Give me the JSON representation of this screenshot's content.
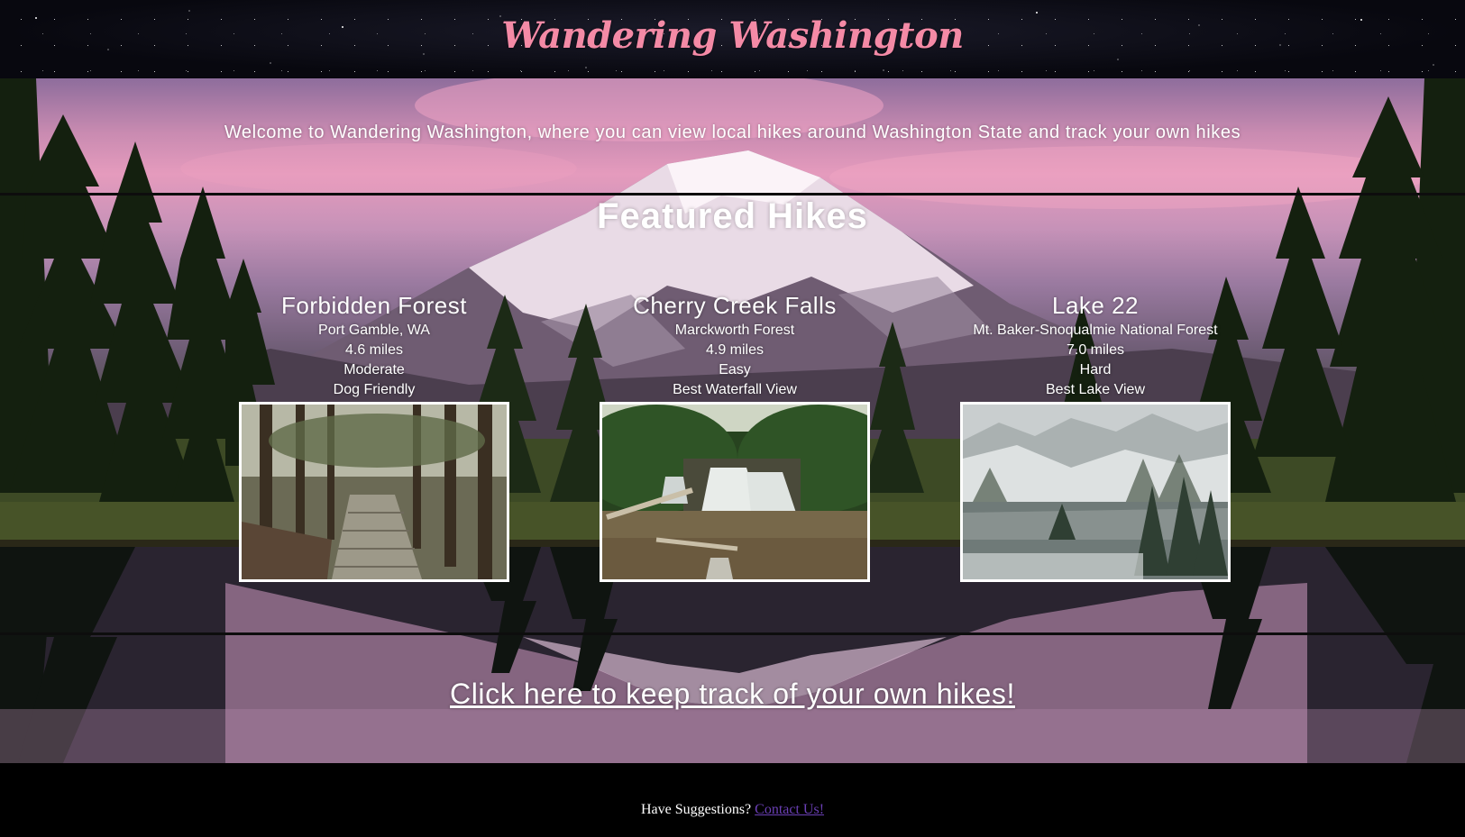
{
  "header": {
    "title": "Wandering Washington"
  },
  "intro": {
    "welcome_text": "Welcome to Wandering Washington, where you can view local hikes around Washington State and track your own hikes"
  },
  "featured": {
    "heading": "Featured Hikes",
    "hikes": [
      {
        "name": "Forbidden Forest",
        "location": "Port Gamble, WA",
        "distance": "4.6 miles",
        "difficulty": "Moderate",
        "feature": "Dog Friendly",
        "photo": "forest-trail"
      },
      {
        "name": "Cherry Creek Falls",
        "location": "Marckworth Forest",
        "distance": "4.9 miles",
        "difficulty": "Easy",
        "feature": "Best Waterfall View",
        "photo": "waterfall"
      },
      {
        "name": "Lake 22",
        "location": "Mt. Baker-Snoqualmie National Forest",
        "distance": "7.0 miles",
        "difficulty": "Hard",
        "feature": "Best Lake View",
        "photo": "snowy-lake"
      }
    ]
  },
  "cta": {
    "link_text": "Click here to keep track of your own hikes!"
  },
  "footer": {
    "prompt": "Have Suggestions?",
    "contact_link": "Contact Us!"
  },
  "colors": {
    "title_pink": "#f48aa6",
    "link_purple": "#6a3fb5",
    "divider": "#0d0d0d"
  }
}
